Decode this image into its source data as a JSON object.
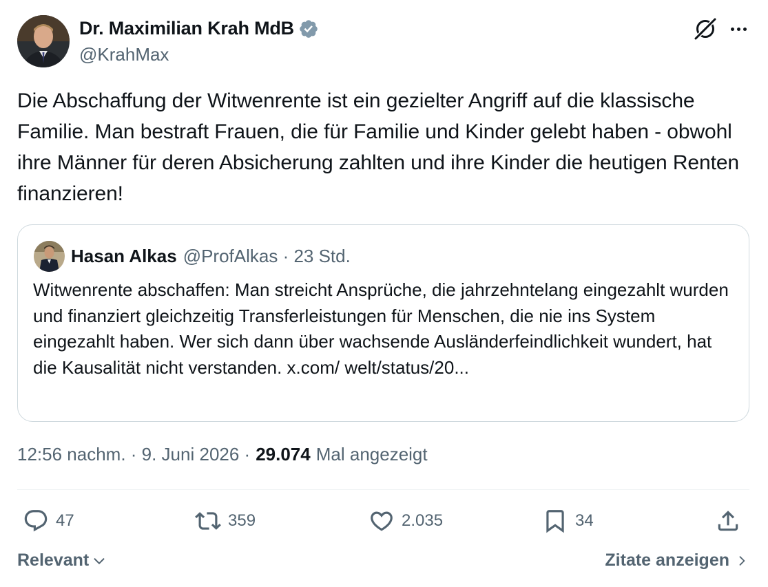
{
  "author": {
    "name": "Dr. Maximilian Krah MdB",
    "handle": "@KrahMax"
  },
  "tweet": {
    "text": "Die Abschaffung der Witwenrente ist ein gezielter Angriff auf die klassische Familie. Man bestraft Frauen, die für Familie und Kinder gelebt haben - obwohl ihre Männer für deren Absicherung zahlten und ihre Kinder die heutigen Renten finanzieren!"
  },
  "quote": {
    "name": "Hasan Alkas",
    "meta": "@ProfAlkas · 23 Std.",
    "text": "Witwenrente abschaffen: Man streicht Ansprüche, die jahrzehntelang eingezahlt wurden und finanziert gleichzeitig Transferleistungen für Menschen, die nie ins System eingezahlt haben. Wer sich dann über wachsende Ausländerfeindlichkeit wundert, hat die Kausalität nicht verstanden. x.com/ welt/status/20..."
  },
  "stats": {
    "timestamp": "12:56 nachm. · 9. Juni 2026 ·",
    "views": "29.074",
    "views_label": "Mal angezeigt"
  },
  "actions": {
    "replies": "47",
    "reposts": "359",
    "likes": "2.035",
    "bookmarks": "34"
  },
  "footer": {
    "sort_label": "Relevant",
    "quotes_link": "Zitate anzeigen"
  },
  "colors": {
    "text": "#0f1419",
    "secondary": "#536471",
    "verified": "#829aab",
    "border": "#cfd9de"
  }
}
